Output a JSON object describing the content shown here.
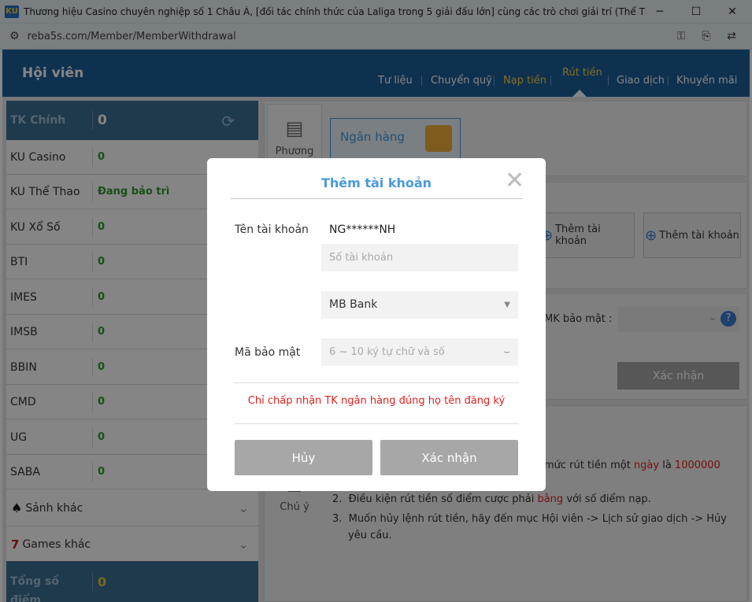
{
  "window": {
    "title": "Thương hiệu Casino chuyên nghiệp số 1 Châu Á, [đối tác chính thức của Laliga trong 5 giải đấu lớn] cùng các trò chơi giải trí (Thể Thao, Casino, E-S...",
    "logo": "KU",
    "url": "reba5s.com/Member/MemberWithdrawal"
  },
  "header": {
    "title": "Hội viên",
    "nav": [
      "Tư liệu",
      "Chuyển quỹ",
      "Nạp tiền",
      "Rút tiền",
      "Giao dịch",
      "Khuyến mãi"
    ],
    "active": "Rút tiền",
    "accent": "#ffd23c",
    "bar_color": "#1e5f99"
  },
  "sidebar": {
    "main": {
      "label": "TK Chính",
      "value": "0"
    },
    "accounts": [
      {
        "label": "KU Casino",
        "value": "0"
      },
      {
        "label": "KU Thể Thao",
        "value": "Đang bảo trì"
      },
      {
        "label": "KU Xổ Số",
        "value": "0"
      },
      {
        "label": "BTI",
        "value": "0"
      },
      {
        "label": "IMES",
        "value": "0"
      },
      {
        "label": "IMSB",
        "value": "0"
      },
      {
        "label": "BBIN",
        "value": "0"
      },
      {
        "label": "CMD",
        "value": "0"
      },
      {
        "label": "UG",
        "value": "0"
      },
      {
        "label": "SABA",
        "value": "0"
      }
    ],
    "groups": [
      {
        "label": "Sảnh khác",
        "icon": "spade-icon"
      },
      {
        "label": "Games khác",
        "icon": "slot-seven-icon"
      }
    ],
    "total": {
      "label": "Tổng số điểm",
      "value": "0"
    }
  },
  "main": {
    "method_label": "Phương",
    "bank_tab": "Ngân hàng",
    "add_account_1": "Thêm tài khoản",
    "add_account_2": "Thêm tài khoản",
    "pin_label": "MK bảo mật :",
    "confirm": "Xác nhận",
    "notes_label": "Chú ý",
    "note1_pre": "mức rút tiền một ",
    "note1_day": "ngày",
    "note1_mid": " là ",
    "note1_amount": "1000000",
    "note2_pre": "Điều kiện rút tiền số điểm cược phải ",
    "note2_red": "bằng",
    "note2_post": " với số điểm nạp.",
    "note3": "Muốn hủy lệnh rút tiền, hãy đến mục Hội viên -> Lịch sử giao dịch -> Hủy yêu cầu."
  },
  "modal": {
    "title": "Thêm tài khoản",
    "account_name_label": "Tên tài khoản",
    "account_name_value": "NG******NH",
    "account_number_placeholder": "Số tài khoản",
    "bank_selected": "MB Bank",
    "pin_label": "Mã bảo mật",
    "pin_placeholder": "6 ~ 10 ký tự chữ và số",
    "note": "Chỉ chấp nhận TK ngân hàng đúng họ tên đăng ký",
    "cancel": "Hủy",
    "confirm": "Xác nhận"
  }
}
